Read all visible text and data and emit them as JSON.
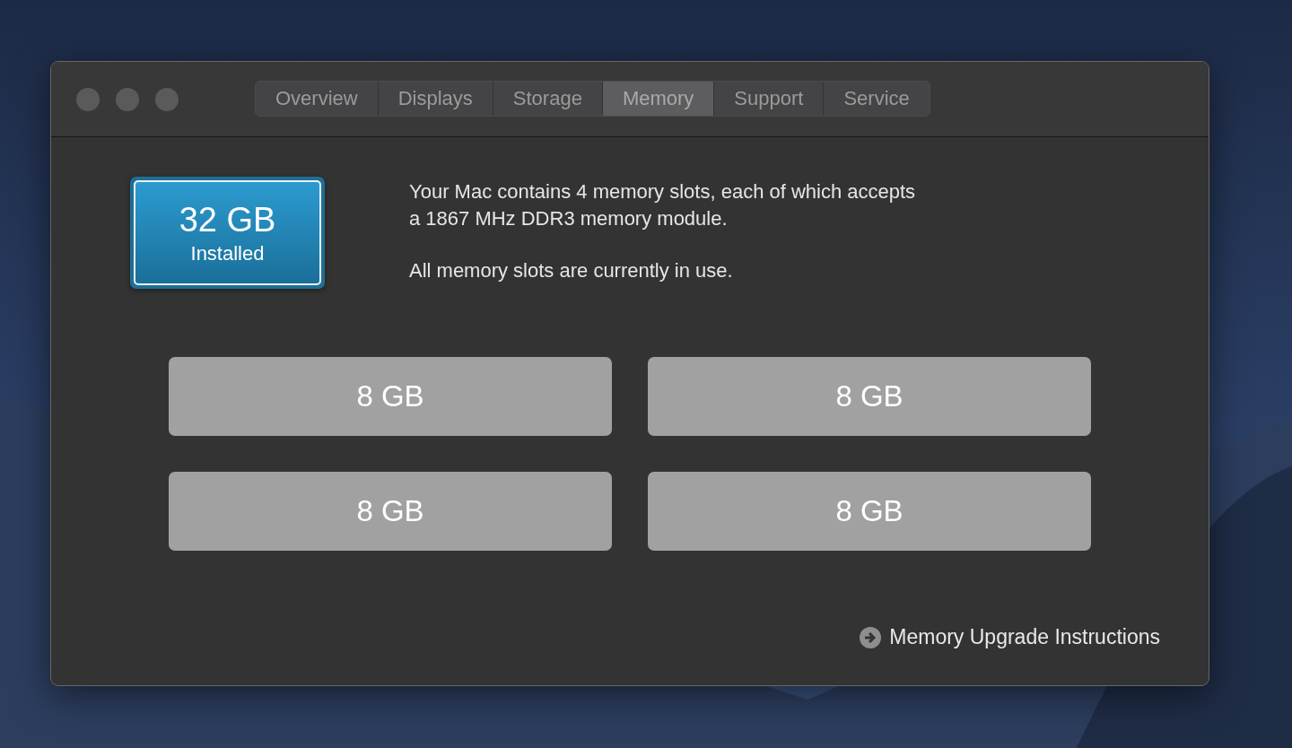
{
  "tabs": [
    {
      "label": "Overview",
      "selected": false
    },
    {
      "label": "Displays",
      "selected": false
    },
    {
      "label": "Storage",
      "selected": false
    },
    {
      "label": "Memory",
      "selected": true
    },
    {
      "label": "Support",
      "selected": false
    },
    {
      "label": "Service",
      "selected": false
    }
  ],
  "installed": {
    "size": "32 GB",
    "label": "Installed"
  },
  "description_lines": [
    "Your Mac contains 4 memory slots, each of which accepts",
    "a 1867 MHz DDR3 memory module."
  ],
  "status": "All memory slots are currently in use.",
  "slots": [
    {
      "size": "8 GB"
    },
    {
      "size": "8 GB"
    },
    {
      "size": "8 GB"
    },
    {
      "size": "8 GB"
    }
  ],
  "link": "Memory Upgrade Instructions"
}
